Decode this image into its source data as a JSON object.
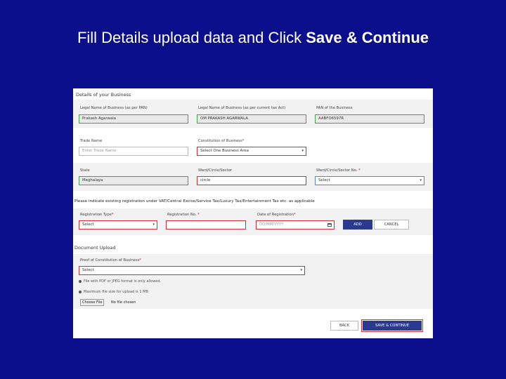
{
  "slide": {
    "title_prefix": "Fill Details upload data and Click ",
    "title_bold": "Save & Continue"
  },
  "business": {
    "section_title": "Details of your Business",
    "legal_name_pan_label": "Legal Name of Business (as per PAN)",
    "legal_name_pan_value": "Prakash Agarwala",
    "legal_name_tax_label": "Legal Name of Business (as per current tax Act)",
    "legal_name_tax_value": "OM PRAKASH AGARWALA",
    "pan_label": "PAN of the Business",
    "pan_value": "AABFO6597R",
    "trade_name_label": "Trade Name",
    "trade_name_placeholder": "Enter Trade Name",
    "constitution_label": "Constitution of Business",
    "constitution_value": "Select One Business Area",
    "state_label": "State",
    "state_value": "Meghalaya",
    "ward_label": "Ward/Circle/Sector",
    "ward_value": "circle",
    "ward_no_label": "Ward/Circle/Sector No.",
    "ward_no_value": "Select",
    "required_mark": "*"
  },
  "registration": {
    "instruction": "Please indicate existing registration under VAT/Central Excise/Service Tax/Luxury Tax/Entertainment Tax etc. as applicable",
    "type_label": "Registration Type",
    "type_value": "Select",
    "number_label": "Registration No.",
    "number_value": "",
    "date_label": "Date of Registration",
    "date_placeholder": "DD/MM/YYYY",
    "add_label": "ADD",
    "cancel_label": "CANCEL"
  },
  "documents": {
    "section_title": "Document Upload",
    "proof_label": "Proof of Constitution of Business",
    "proof_value": "Select",
    "note_format": "File with PDF or JPEG format is only allowed.",
    "note_size": "Maximum file size for upload is 1 MB",
    "choose_file_label": "Choose File",
    "no_file_text": "No file chosen"
  },
  "actions": {
    "back_label": "BACK",
    "save_label": "SAVE & CONTINUE"
  },
  "colors": {
    "slide_bg": "#0b0f8c",
    "valid_border": "#46a24a",
    "error_border": "#d32f2f",
    "primary_button": "#2b3a8f"
  }
}
